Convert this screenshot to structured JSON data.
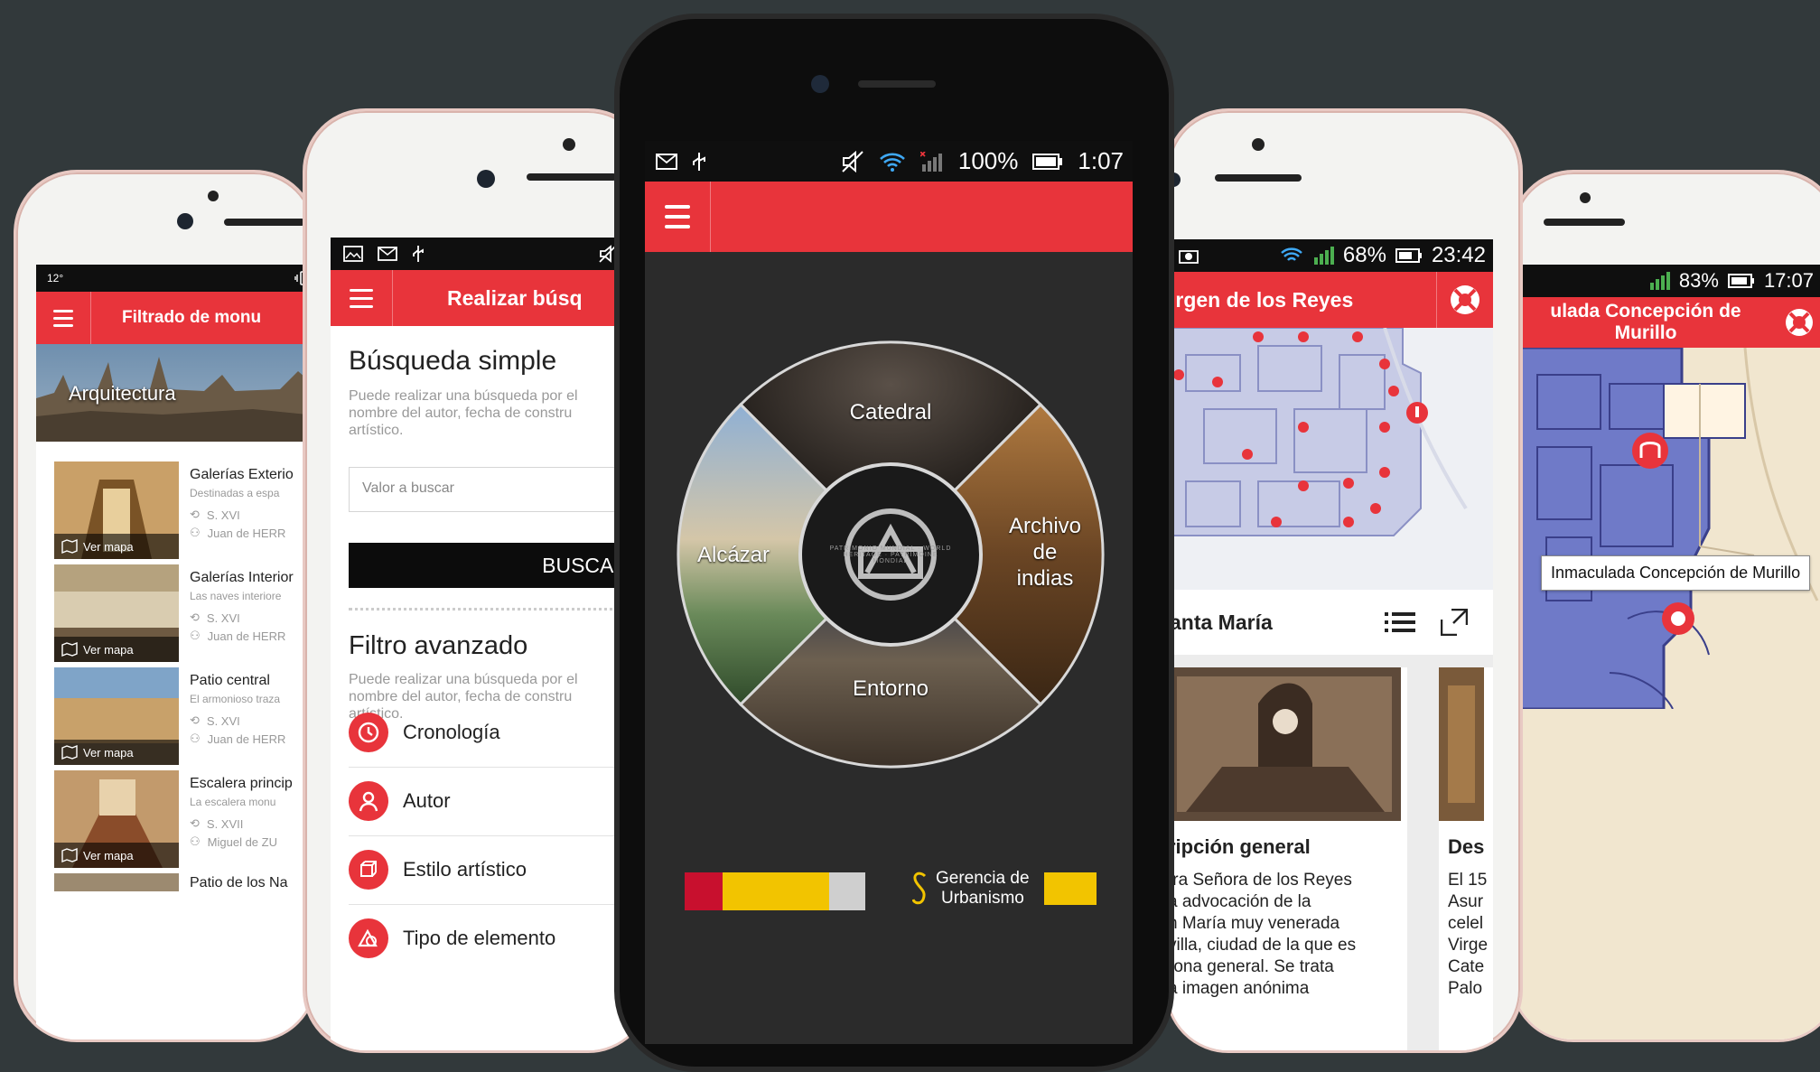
{
  "colors": {
    "accent": "#e8343b",
    "background": "#32393b"
  },
  "phone1": {
    "status": {
      "left": "12°"
    },
    "toolbar_title": "Filtrado de monu",
    "hero_label": "Arquitectura",
    "items": [
      {
        "title": "Galerías Exterio",
        "subtitle": "Destinadas a espa",
        "map_label": "Ver mapa",
        "century": "S. XVI",
        "author": "Juan de HERR"
      },
      {
        "title": "Galerías Interior",
        "subtitle": "Las naves interiore",
        "map_label": "Ver mapa",
        "century": "S. XVI",
        "author": "Juan de HERR"
      },
      {
        "title": "Patio central",
        "subtitle": "El armonioso traza",
        "map_label": "Ver mapa",
        "century": "S. XVI",
        "author": "Juan de HERR"
      },
      {
        "title": "Escalera princip",
        "subtitle": "La escalera monu",
        "map_label": "Ver mapa",
        "century": "S. XVII",
        "author": "Miguel de ZU"
      },
      {
        "title": "Patio de los Na",
        "subtitle": "",
        "map_label": "",
        "century": "",
        "author": ""
      }
    ]
  },
  "phone2": {
    "toolbar_title": "Realizar búsq",
    "simple": {
      "heading": "Búsqueda simple",
      "description": "Puede realizar una búsqueda por el nombre del autor, fecha de constru artístico.",
      "input_placeholder": "Valor a buscar",
      "button": "BUSCAR"
    },
    "advanced": {
      "heading": "Filtro avanzado",
      "description": "Puede realizar una búsqueda por el nombre del autor, fecha de constru artístico."
    },
    "filters": [
      {
        "label": "Cronología",
        "icon": "clock-icon"
      },
      {
        "label": "Autor",
        "icon": "user-icon"
      },
      {
        "label": "Estilo artístico",
        "icon": "cube-icon"
      },
      {
        "label": "Tipo de elemento",
        "icon": "shapes-icon"
      }
    ]
  },
  "phone3": {
    "status": {
      "battery": "100%",
      "time": "1:07"
    },
    "wheel": {
      "top": "Catedral",
      "left": "Alcázar",
      "right_lines": [
        "Archivo",
        "de",
        "indias"
      ],
      "bottom": "Entorno",
      "emblem_text": "PATRIMONIO MUNDIAL · WORLD HERITAGE · PATRIMOINE MONDIAL"
    },
    "logo_right_lines": [
      "Gerencia de",
      "Urbanismo"
    ]
  },
  "phone4": {
    "status": {
      "battery": "68%",
      "time": "23:42"
    },
    "toolbar_title": "irgen de los Reyes",
    "section_title": "anta María",
    "cards": [
      {
        "heading": "ripción general",
        "lines": [
          "tra Señora de los Reyes",
          "a advocación de la",
          "n María muy venerada",
          "villa, ciudad de la que es",
          "rona general. Se trata",
          "a imagen anónima"
        ]
      },
      {
        "heading": "Des",
        "lines": [
          "El 15",
          "Asur",
          "celel",
          "Virge",
          "Cate",
          "Palo"
        ]
      }
    ]
  },
  "phone5": {
    "status": {
      "battery": "83%",
      "time": "17:07"
    },
    "toolbar_title_lines": [
      "ulada Concepción de",
      "Murillo"
    ],
    "map_tooltip": "Inmaculada Concepción de Murillo"
  }
}
